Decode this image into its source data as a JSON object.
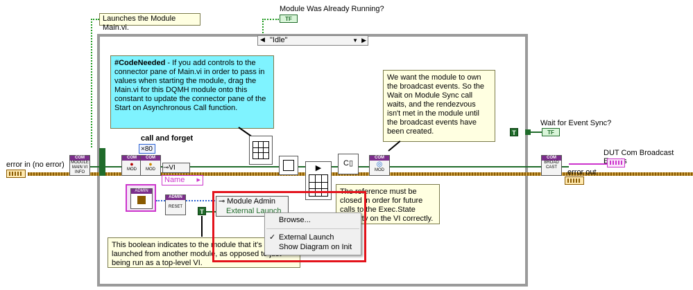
{
  "notes": {
    "launches": "Launches the Module Main.vi.",
    "code_needed_head": "#CodeNeeded",
    "code_needed_body": " - If you add controls to the connector pane of Main.vi in order to pass in values when starting the module, drag the Main.vi for this DQMH module onto this constant to update the connector pane of the Start on Asynchronous Call function.",
    "own_events": "We want the module to own the broadcast events. So the Wait on Module Sync call waits, and the rendezvous isn't met in the module until the broadcast events have been created.",
    "reference_closed": "The reference must be closed in order for future calls to the Exec.State property on the VI correctly.",
    "boolean_indicates": "This boolean indicates to the module that it's been launched from another module, as opposed to just being run as a top-level VI."
  },
  "labels": {
    "module_was_running": "Module Was Already Running?",
    "case_selector": "\"Idle\"",
    "call_and_forget": "call and forget",
    "error_in": "error in (no error)",
    "wait_event_sync": "Wait for Event Sync?",
    "dut_broadcast": "DUT Com Broadcast Events",
    "error_out": "error out",
    "name_field": "Name",
    "vi_node": "VI",
    "module_admin": "Module Admin",
    "external_launch": "External Launch",
    "numeric_80": "80",
    "tf": "TF",
    "t_const": "T"
  },
  "nodes": {
    "module_main_vi_info": [
      "COM",
      "MODULE",
      "MAIN VI",
      "INFO"
    ],
    "mod_a": [
      "COM",
      "MOD"
    ],
    "mod_b": [
      "COM",
      "MOD"
    ],
    "admin_icon": "ADMIN",
    "reset": [
      "ADMIN",
      "RESET"
    ],
    "wait_mod": [
      "COM",
      "MOD"
    ],
    "broadcast": [
      "COM",
      "BROAD",
      "CAST"
    ]
  },
  "context_menu": {
    "items": [
      {
        "label": "Browse...",
        "checked": false
      },
      {
        "label": "External Launch",
        "checked": true
      },
      {
        "label": "Show Diagram on Init",
        "checked": false
      }
    ]
  },
  "colors": {
    "highlight": "#e3121b",
    "note_yellow": "#ffffe1",
    "note_cyan": "#7ff3ff",
    "cluster_wire": "#b07a1e",
    "boolean_wire": "#1f6b2a",
    "class_purple": "#7b2d8b"
  }
}
